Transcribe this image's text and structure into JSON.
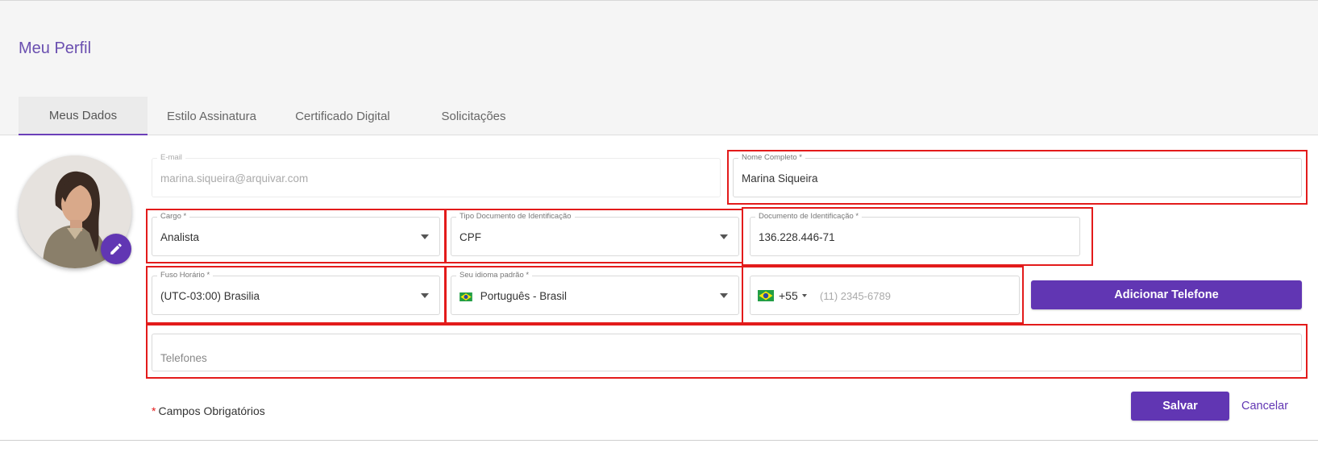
{
  "page": {
    "title": "Meu Perfil"
  },
  "tabs": [
    {
      "label": "Meus Dados",
      "active": true
    },
    {
      "label": "Estilo Assinatura",
      "active": false
    },
    {
      "label": "Certificado Digital",
      "active": false
    },
    {
      "label": "Solicitações",
      "active": false
    }
  ],
  "avatar": {
    "edit_icon": "pencil-icon"
  },
  "form": {
    "email": {
      "label": "E-mail",
      "value": "marina.siqueira@arquivar.com"
    },
    "nome": {
      "label": "Nome Completo *",
      "value": "Marina Siqueira"
    },
    "cargo": {
      "label": "Cargo *",
      "value": "Analista"
    },
    "tipo_doc": {
      "label": "Tipo Documento de Identificação",
      "value": "CPF"
    },
    "documento": {
      "label": "Documento de Identificação *",
      "value": "136.228.446-71"
    },
    "fuso": {
      "label": "Fuso Horário *",
      "value": "(UTC-03:00) Brasilia"
    },
    "idioma": {
      "label": "Seu idioma padrão *",
      "value": "Português - Brasil",
      "flag": "brazil-flag"
    },
    "telefone": {
      "country_code": "+55",
      "placeholder": "(11) 2345-6789",
      "flag": "brazil-flag"
    },
    "telefones": {
      "placeholder": "Telefones"
    }
  },
  "buttons": {
    "add_phone": "Adicionar Telefone",
    "save": "Salvar",
    "cancel": "Cancelar"
  },
  "required_note": {
    "star": "*",
    "text": "Campos Obrigatórios"
  },
  "colors": {
    "accent": "#6136b3",
    "title": "#6a4fb0",
    "highlight": "#e31b1b"
  }
}
